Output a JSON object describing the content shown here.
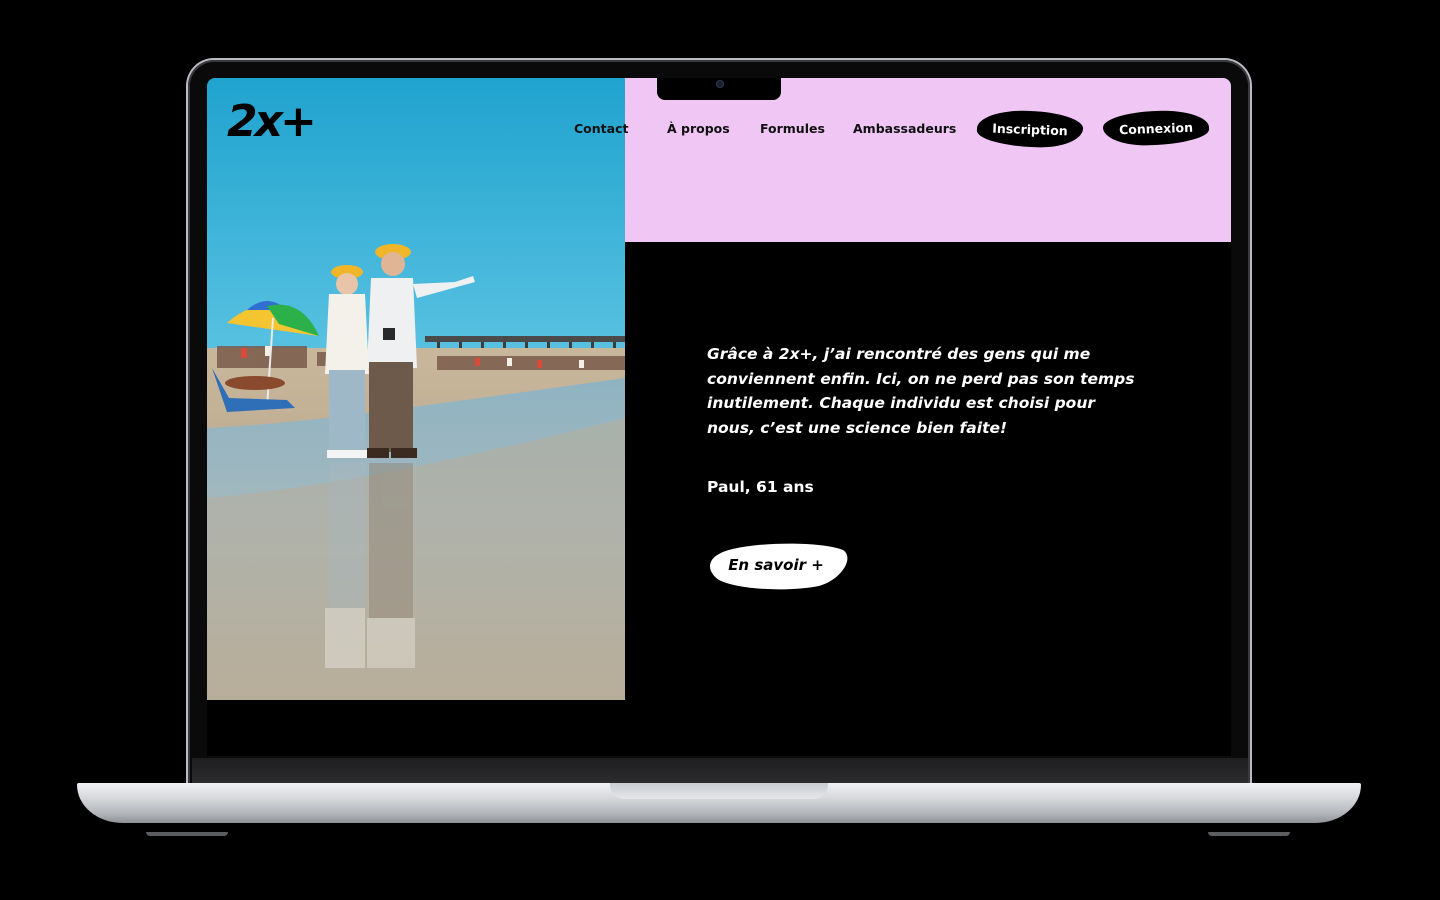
{
  "site": {
    "logo": "2x+",
    "nav": {
      "contact": "Contact",
      "about": "À propos",
      "plans": "Formules",
      "ambassadors": "Ambassadeurs"
    },
    "buttons": {
      "signup": "Inscription",
      "login": "Connexion"
    }
  },
  "hero": {
    "quote": "Grâce à 2x+, j’ai rencontré des gens qui me conviennent enfin. Ici, on ne perd pas son temps inutilement. Chaque individu est choisi pour nous, c’est une science bien faite!",
    "author": "Paul, 61 ans",
    "cta": "En savoir +"
  },
  "colors": {
    "accent_pink": "#f0c6f5",
    "background": "#000000",
    "text_light": "#ffffff"
  }
}
